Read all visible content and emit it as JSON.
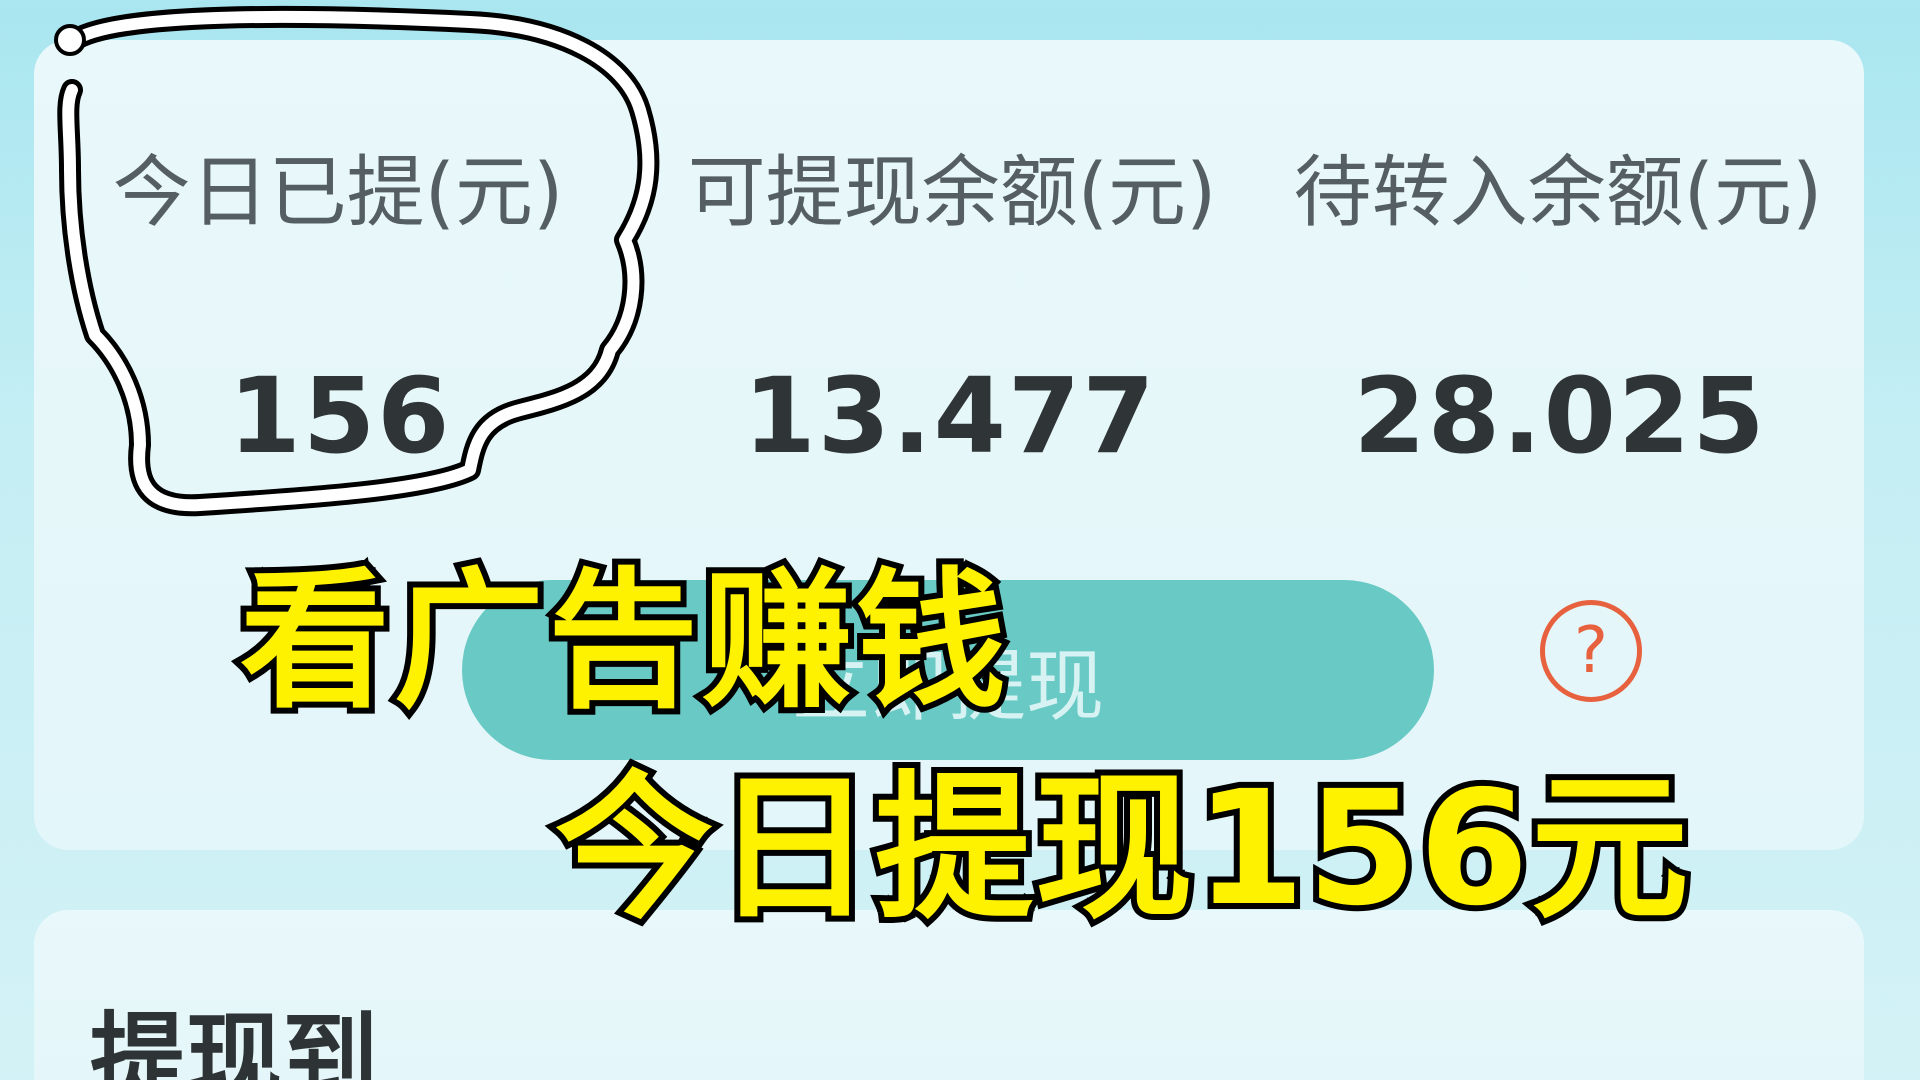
{
  "stats": [
    {
      "label": "今日已提(元)",
      "value": "156"
    },
    {
      "label": "可提现余额(元)",
      "value": "13.477"
    },
    {
      "label": "待转入余额(元)",
      "value": "28.025"
    }
  ],
  "withdraw_button_label": "立即提现",
  "help_icon": "question-mark-circle-icon",
  "help_glyph": "?",
  "withdraw_to_title": "提现到",
  "captions": {
    "line1": "看广告赚钱",
    "line2": "今日提现156元"
  },
  "colors": {
    "button": "#68c9c5",
    "help": "#e8613f",
    "caption_fill": "#fff200"
  }
}
